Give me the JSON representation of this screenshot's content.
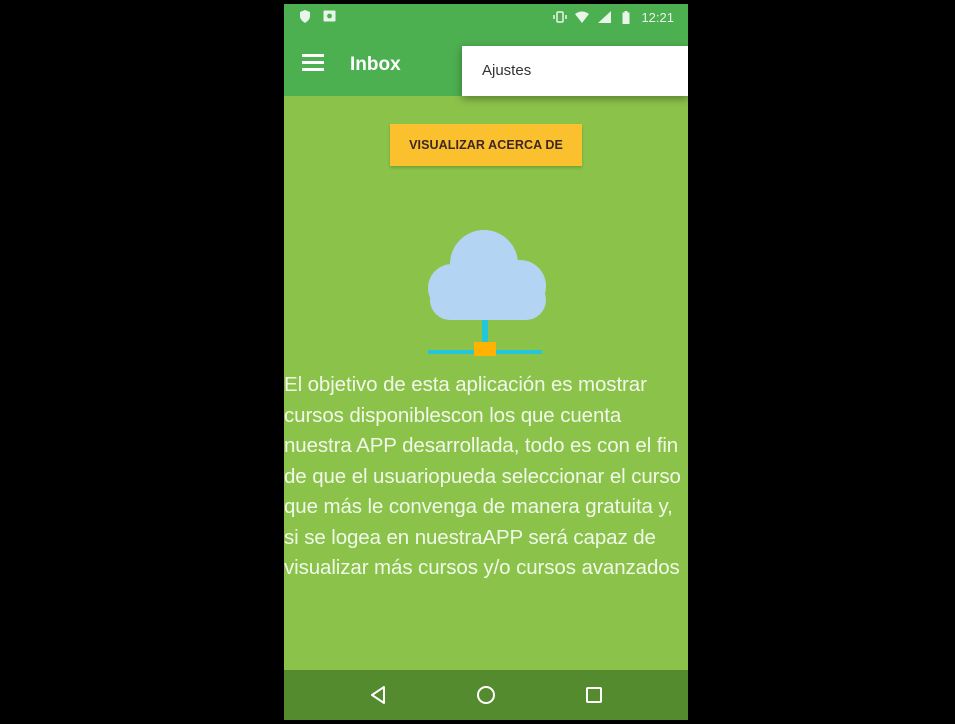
{
  "status_bar": {
    "time": "12:21",
    "icons": [
      "shield-icon",
      "image-icon",
      "vibrate-icon",
      "wifi-icon",
      "signal-icon",
      "battery-icon"
    ]
  },
  "app_bar": {
    "title": "Inbox",
    "menu_icon": "hamburger-menu-icon"
  },
  "overflow_menu": {
    "items": [
      {
        "label": "Ajustes"
      }
    ]
  },
  "content": {
    "about_button_label": "VISUALIZAR ACERCA DE",
    "illustration": "cloud-network-icon",
    "description": "El objetivo de esta aplicación es mostrar cursos disponiblescon los que cuenta nuestra APP desarrollada, todo es con el fin de que el usuariopueda seleccionar el curso que más le convenga de manera gratuita y, si se logea en nuestraAPP será capaz de visualizar más cursos y/o cursos avanzados"
  },
  "nav_bar": {
    "buttons": [
      "back-icon",
      "home-icon",
      "recents-icon"
    ]
  },
  "colors": {
    "app_bar": "#4caf50",
    "content_background": "#8bc34a",
    "button": "#fbc02d",
    "nav_bar": "#558b2f"
  }
}
